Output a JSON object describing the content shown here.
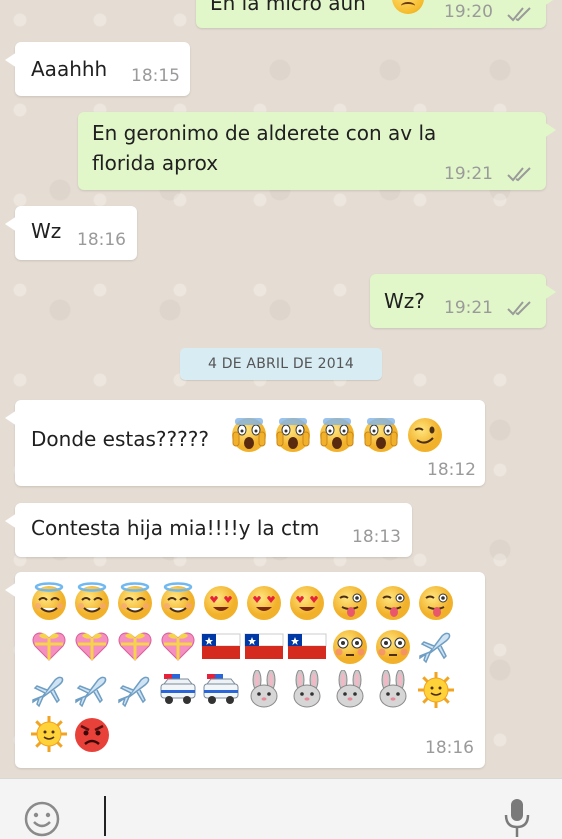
{
  "messages": [
    {
      "dir": "out",
      "text": "En la micro aun",
      "time": "19:20",
      "ticks": true
    },
    {
      "dir": "in",
      "text": "Aaahhh",
      "time": "18:15"
    },
    {
      "dir": "out",
      "text": "En geronimo de alderete con av la florida aprox",
      "time": "19:21",
      "ticks": true
    },
    {
      "dir": "in",
      "text": "Wz",
      "time": "18:16"
    },
    {
      "dir": "out",
      "text": "Wz?",
      "time": "19:21",
      "ticks": true
    },
    {
      "dir": "in",
      "text": "Donde estas?????",
      "time": "18:12",
      "emojis": [
        "screaming-face",
        "screaming-face",
        "screaming-face",
        "screaming-face",
        "winking-face"
      ]
    },
    {
      "dir": "in",
      "text": "Contesta hija mia!!!!y la ctm",
      "time": "18:13"
    },
    {
      "dir": "in",
      "text": "",
      "time": "18:16",
      "emojis": [
        "halo-face",
        "halo-face",
        "halo-face",
        "halo-face",
        "heart-eyes-face",
        "heart-eyes-face",
        "heart-eyes-face",
        "tongue-wink-face",
        "tongue-wink-face",
        "tongue-wink-face",
        "gift-heart",
        "gift-heart",
        "gift-heart",
        "gift-heart",
        "chile-flag",
        "chile-flag",
        "chile-flag",
        "flushed-face",
        "flushed-face",
        "airplane",
        "airplane",
        "airplane",
        "airplane",
        "police-car",
        "police-car",
        "rabbit-face",
        "rabbit-face",
        "rabbit-face",
        "rabbit-face",
        "sun-face",
        "sun-face",
        "pouting-face"
      ]
    }
  ],
  "date_divider": "4 DE ABRIL DE 2014",
  "input_bar": {
    "placeholder": "",
    "emoji_icon": "smiley-icon",
    "mic_icon": "microphone-icon"
  },
  "colors": {
    "incoming": "#ffffff",
    "outgoing": "#e1f7c9",
    "tick": "#9a9a9a",
    "date_chip": "#d8ecf4"
  }
}
